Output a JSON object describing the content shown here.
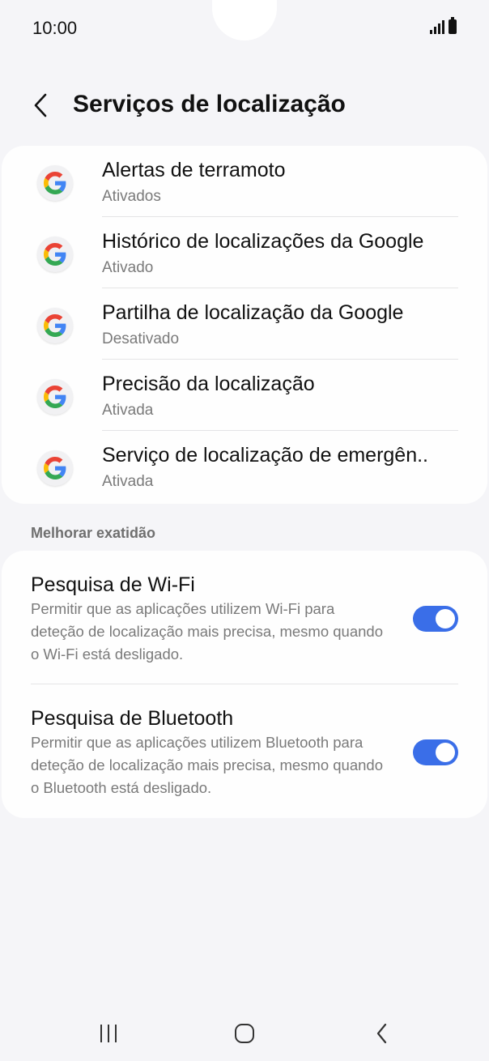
{
  "status_bar": {
    "time": "10:00"
  },
  "header": {
    "title": "Serviços de localização"
  },
  "services": [
    {
      "title": "Alertas de terramoto",
      "status": "Ativados"
    },
    {
      "title": "Histórico de localizações da Google",
      "status": "Ativado"
    },
    {
      "title": "Partilha de localização da Google",
      "status": "Desativado"
    },
    {
      "title": "Precisão da localização",
      "status": "Ativada"
    },
    {
      "title": "Serviço de localização de emergên..",
      "status": "Ativada"
    }
  ],
  "improve_section": {
    "label": "Melhorar exatidão",
    "wifi": {
      "title": "Pesquisa de Wi-Fi",
      "description": "Permitir que as aplicações utilizem Wi-Fi para deteção de localização mais precisa, mesmo quando o Wi-Fi está desligado.",
      "enabled": true
    },
    "bluetooth": {
      "title": "Pesquisa de Bluetooth",
      "description": "Permitir que as aplicações utilizem Bluetooth para deteção de localização mais precisa, mesmo quando o Bluetooth está desligado.",
      "enabled": true
    }
  },
  "colors": {
    "accent": "#3a6ee8",
    "background": "#f5f5f8",
    "card": "#fefefe"
  },
  "icons": [
    "back-icon",
    "google-icon",
    "recents-icon",
    "home-icon",
    "nav-back-icon",
    "signal-icon",
    "battery-icon"
  ]
}
